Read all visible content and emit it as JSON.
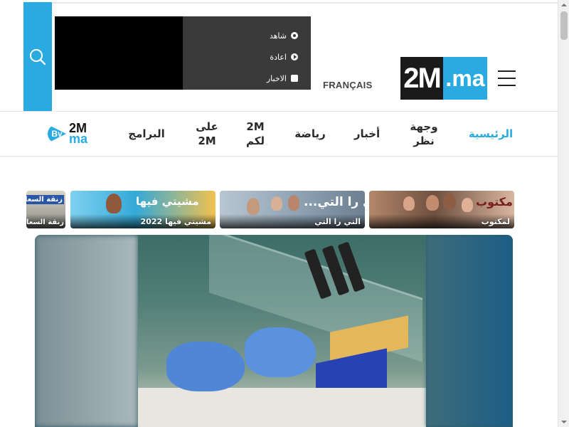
{
  "header": {
    "lang_link": "FRANÇAIS",
    "logo_left": "2M",
    "logo_right": ".ma"
  },
  "player_menu": [
    {
      "label": "شاهد",
      "icon": "live-icon"
    },
    {
      "label": "اعادة",
      "icon": "replay-icon"
    },
    {
      "label": "الاخبار",
      "icon": "news-icon"
    }
  ],
  "nav": {
    "items": [
      {
        "label": "الرئيسية",
        "active": true
      },
      {
        "label": "وجهة نظر",
        "active": false
      },
      {
        "label": "أخبار",
        "active": false
      },
      {
        "label": "رياضة",
        "active": false
      },
      {
        "label": "2M لكم",
        "active": false
      },
      {
        "label": "على 2M",
        "active": false
      },
      {
        "label": "البرامج",
        "active": false
      }
    ],
    "by2m": {
      "by": "By",
      "top": "2M",
      "bottom": "ma"
    }
  },
  "programs": [
    {
      "label": "لمكتوب",
      "art_title": "مكتوب"
    },
    {
      "label": "التي را التي",
      "art_title": "التي را التي..."
    },
    {
      "label": "مشيتي فيها 2022",
      "art_title": "مشيتي فيها"
    },
    {
      "label": "زنقة السعادة",
      "art_title": "زنقة السعادة"
    }
  ],
  "colors": {
    "accent": "#29abe2",
    "player_bg": "#000000",
    "menu_bg": "#3a3a3a",
    "text": "#2a2a2a"
  }
}
